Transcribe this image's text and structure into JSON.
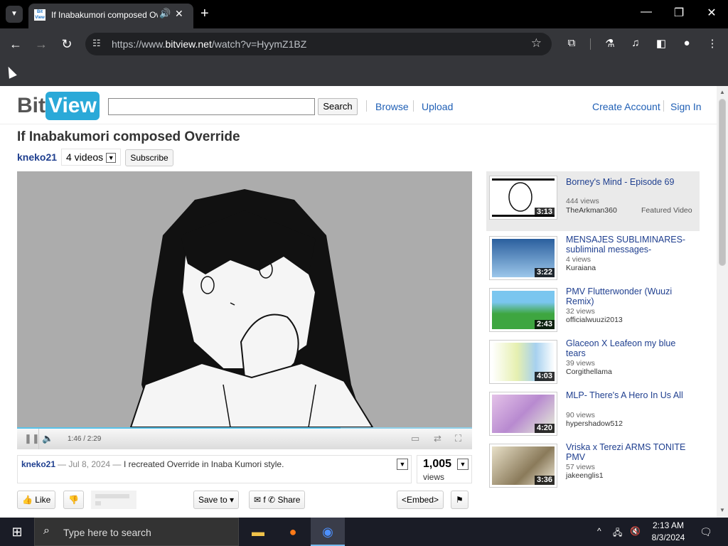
{
  "browser": {
    "tab_title": "If Inabakumori composed Override",
    "favicon_text": "Bit\nView",
    "url_prefix": "https://www.",
    "url_domain": "bitview.net",
    "url_path": "/watch?v=HyymZ1BZ"
  },
  "header": {
    "logo_bit": "Bit",
    "logo_view": "View",
    "search_value": "",
    "search_button": "Search",
    "nav": [
      "Browse",
      "Upload"
    ],
    "create_account": "Create Account",
    "sign_in": "Sign In"
  },
  "video": {
    "title": "If Inabakumori composed Override",
    "uploader": "kneko21",
    "video_count": "4 videos",
    "subscribe": "Subscribe",
    "time": "1:46 / 2:29",
    "progress": 0.711,
    "date": "— Jul 8, 2024 —",
    "description": "I recreated Override in Inaba Kumori style.",
    "views": "1,005",
    "views_label": "views"
  },
  "actions": {
    "like": "Like",
    "save_to": "Save to",
    "share": "Share",
    "embed": "<Embed>"
  },
  "sidebar": [
    {
      "title": "Borney's Mind - Episode 69",
      "views": "444 views",
      "author": "TheArkman360",
      "duration": "3:13",
      "featured": "Featured Video",
      "thumb_color": "#ffffff"
    },
    {
      "title": "MENSAJES SUBLIMINARES- subliminal messages-",
      "views": "4 views",
      "author": "Kuraiana",
      "duration": "3:22",
      "thumb_color": "#4b8fcb"
    },
    {
      "title": "PMV Flutterwonder (Wuuzi Remix)",
      "views": "32 views",
      "author": "officialwuuzi2013",
      "duration": "2:43",
      "thumb_color": "#5cbb4c"
    },
    {
      "title": "Glaceon X Leafeon my blue tears",
      "views": "39 views",
      "author": "Corgithellama",
      "duration": "4:03",
      "thumb_color": "#d9e8a6"
    },
    {
      "title": "MLP- There's A Hero In Us All",
      "views": "90 views",
      "author": "hypershadow512",
      "duration": "4:20",
      "thumb_color": "#d9b2d9"
    },
    {
      "title": "Vriska x Terezi ARMS TONITE PMV",
      "views": "57 views",
      "author": "jakeenglis1",
      "duration": "3:36",
      "thumb_color": "#c9b89a"
    }
  ],
  "taskbar": {
    "search_placeholder": "Type here to search",
    "time": "2:13 AM",
    "date": "8/3/2024"
  },
  "icons": {
    "like": "thumbs-up-icon",
    "dislike": "thumbs-down-icon",
    "share": "share-icon",
    "flag": "flag-icon"
  }
}
